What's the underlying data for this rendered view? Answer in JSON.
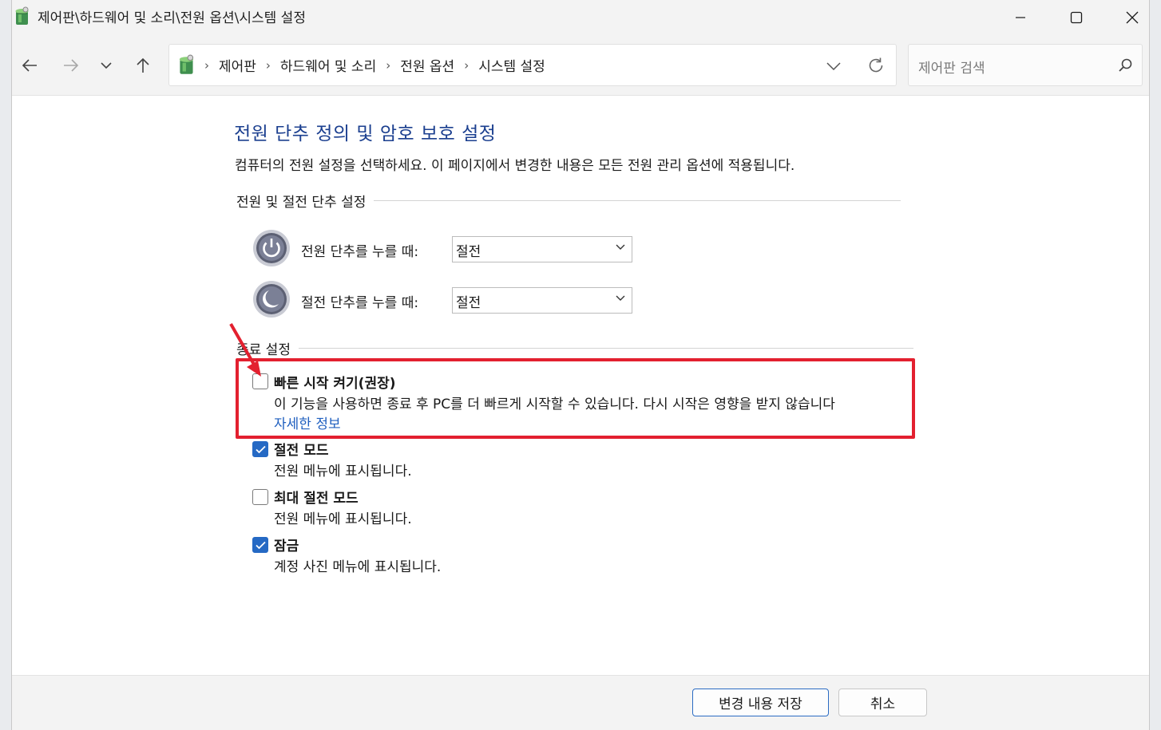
{
  "window": {
    "title": "제어판\\하드웨어 및 소리\\전원 옵션\\시스템 설정"
  },
  "nav": {
    "crumbs": [
      "제어판",
      "하드웨어 및 소리",
      "전원 옵션",
      "시스템 설정"
    ],
    "search_placeholder": "제어판 검색"
  },
  "page": {
    "title": "전원 단추 정의 및 암호 보호 설정",
    "description": "컴퓨터의 전원 설정을 선택하세요. 이 페이지에서 변경한 내용은 모든 전원 관리 옵션에 적용됩니다."
  },
  "power_buttons": {
    "group_label": "전원 및 절전 단추 설정",
    "power_label": "전원 단추를 누를 때:",
    "power_value": "절전",
    "sleep_label": "절전 단추를 누를 때:",
    "sleep_value": "절전"
  },
  "shutdown": {
    "group_label": "종료 설정",
    "fast_startup": {
      "title": "빠른 시작 켜기(권장)",
      "checked": false,
      "description": "이 기능을 사용하면 종료 후 PC를 더 빠르게 시작할 수 있습니다. 다시 시작은 영향을 받지 않습니다",
      "link": "자세한 정보"
    },
    "sleep": {
      "title": "절전 모드",
      "checked": true,
      "description": "전원 메뉴에 표시됩니다."
    },
    "hibernate": {
      "title": "최대 절전 모드",
      "checked": false,
      "description": "전원 메뉴에 표시됩니다."
    },
    "lock": {
      "title": "잠금",
      "checked": true,
      "description": "계정 사진 메뉴에 표시됩니다."
    }
  },
  "footer": {
    "save_label": "변경 내용 저장",
    "cancel_label": "취소"
  },
  "colors": {
    "accent": "#2569c4",
    "title_blue": "#1b3f8f",
    "highlight_red": "#e3202f"
  }
}
